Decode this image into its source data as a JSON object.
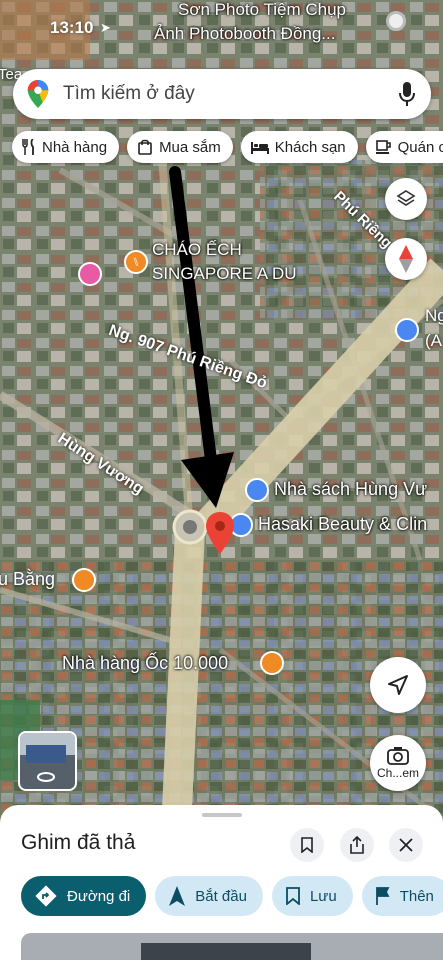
{
  "status_bar": {
    "time": "13:10"
  },
  "search": {
    "placeholder": "Tìm kiếm ở đây"
  },
  "chips": [
    {
      "label": "Nhà hàng",
      "icon": "fork-knife-icon"
    },
    {
      "label": "Mua sắm",
      "icon": "shopping-bag-icon"
    },
    {
      "label": "Khách sạn",
      "icon": "bed-icon"
    },
    {
      "label": "Quán c",
      "icon": "coffee-cup-icon"
    }
  ],
  "map_labels": {
    "top_place_1": "Sơn Photo Tiệm Chụp",
    "top_place_2": "Ảnh Photobooth Đồng...",
    "top_left_partial": "Tea",
    "top_right_street": "Phú Riềng Đỏ",
    "restaurant_1": "CHÁO ẾCH",
    "restaurant_2": "SINGAPORE A DU",
    "road_1": "Ng. 907 Phú Riềng Đỏ",
    "road_2": "Hùng Vương",
    "right_partial_1": "Ng",
    "right_partial_2": "(A",
    "bookstore": "Nhà sách Hùng Vư",
    "beauty": "Hasaki Beauty & Clin",
    "left_food": "u Bằng",
    "snail_restaurant": "Nhà hàng Ốc 10.000",
    "camera_label": "Ch...em"
  },
  "sheet": {
    "title": "Ghim đã thả",
    "actions": [
      {
        "label": "Đường đi",
        "icon": "directions-icon"
      },
      {
        "label": "Bắt đầu",
        "icon": "navigation-arrow-icon"
      },
      {
        "label": "Lưu",
        "icon": "bookmark-icon"
      },
      {
        "label": "Thên",
        "icon": "flag-icon"
      }
    ]
  },
  "colors": {
    "accent": "#0b5e6e",
    "pin": "#ea4335",
    "poi_blue": "#4a87f0",
    "poi_orange": "#f08a24",
    "poi_pink": "#e85aa4"
  }
}
